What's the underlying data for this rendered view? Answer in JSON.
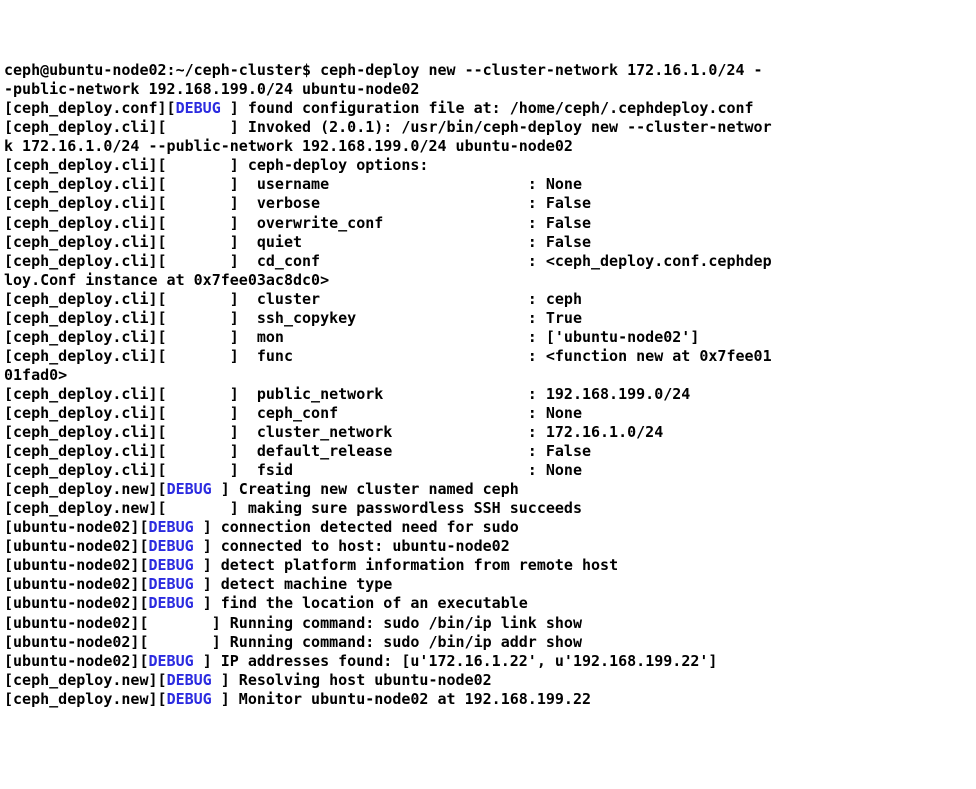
{
  "lines": [
    [
      [
        "ceph@ubuntu-node02:~/ceph-cluster$ ceph-deploy new --cluster-network 172.16.1.0/24 -"
      ]
    ],
    [
      [
        "-public-network 192.168.199.0/24 ubuntu-node02"
      ]
    ],
    [
      [
        "[ceph_deploy.conf]["
      ],
      [
        "lvl",
        "DEBUG "
      ],
      [
        "] found configuration file at: /home/ceph/.cephdeploy.conf"
      ]
    ],
    [
      [
        "[ceph_deploy.cli][       ] Invoked (2.0.1): /usr/bin/ceph-deploy new --cluster-networ"
      ]
    ],
    [
      [
        "k 172.16.1.0/24 --public-network 192.168.199.0/24 ubuntu-node02"
      ]
    ],
    [
      [
        "[ceph_deploy.cli][       ] ceph-deploy options:"
      ]
    ],
    [
      [
        "[ceph_deploy.cli][       ]  username                      : None"
      ]
    ],
    [
      [
        "[ceph_deploy.cli][       ]  verbose                       : False"
      ]
    ],
    [
      [
        "[ceph_deploy.cli][       ]  overwrite_conf                : False"
      ]
    ],
    [
      [
        "[ceph_deploy.cli][       ]  quiet                         : False"
      ]
    ],
    [
      [
        "[ceph_deploy.cli][       ]  cd_conf                       : <ceph_deploy.conf.cephdep"
      ]
    ],
    [
      [
        "loy.Conf instance at 0x7fee03ac8dc0>"
      ]
    ],
    [
      [
        "[ceph_deploy.cli][       ]  cluster                       : ceph"
      ]
    ],
    [
      [
        "[ceph_deploy.cli][       ]  ssh_copykey                   : True"
      ]
    ],
    [
      [
        "[ceph_deploy.cli][       ]  mon                           : ['ubuntu-node02']"
      ]
    ],
    [
      [
        "[ceph_deploy.cli][       ]  func                          : <function new at 0x7fee01"
      ]
    ],
    [
      [
        "01fad0>"
      ]
    ],
    [
      [
        "[ceph_deploy.cli][       ]  public_network                : 192.168.199.0/24"
      ]
    ],
    [
      [
        "[ceph_deploy.cli][       ]  ceph_conf                     : None"
      ]
    ],
    [
      [
        "[ceph_deploy.cli][       ]  cluster_network               : 172.16.1.0/24"
      ]
    ],
    [
      [
        "[ceph_deploy.cli][       ]  default_release               : False"
      ]
    ],
    [
      [
        "[ceph_deploy.cli][       ]  fsid                          : None"
      ]
    ],
    [
      [
        "[ceph_deploy.new]["
      ],
      [
        "lvl",
        "DEBUG "
      ],
      [
        "] Creating new cluster named ceph"
      ]
    ],
    [
      [
        "[ceph_deploy.new][       ] making sure passwordless SSH succeeds"
      ]
    ],
    [
      [
        "[ubuntu-node02]["
      ],
      [
        "lvl",
        "DEBUG "
      ],
      [
        "] connection detected need for sudo"
      ]
    ],
    [
      [
        "[ubuntu-node02]["
      ],
      [
        "lvl",
        "DEBUG "
      ],
      [
        "] connected to host: ubuntu-node02"
      ]
    ],
    [
      [
        "[ubuntu-node02]["
      ],
      [
        "lvl",
        "DEBUG "
      ],
      [
        "] detect platform information from remote host"
      ]
    ],
    [
      [
        "[ubuntu-node02]["
      ],
      [
        "lvl",
        "DEBUG "
      ],
      [
        "] detect machine type"
      ]
    ],
    [
      [
        "[ubuntu-node02]["
      ],
      [
        "lvl",
        "DEBUG "
      ],
      [
        "] find the location of an executable"
      ]
    ],
    [
      [
        "[ubuntu-node02][       ] Running command: sudo /bin/ip link show"
      ]
    ],
    [
      [
        "[ubuntu-node02][       ] Running command: sudo /bin/ip addr show"
      ]
    ],
    [
      [
        "[ubuntu-node02]["
      ],
      [
        "lvl",
        "DEBUG "
      ],
      [
        "] IP addresses found: [u'172.16.1.22', u'192.168.199.22']"
      ]
    ],
    [
      [
        "[ceph_deploy.new]["
      ],
      [
        "lvl",
        "DEBUG "
      ],
      [
        "] Resolving host ubuntu-node02"
      ]
    ],
    [
      [
        "[ceph_deploy.new]["
      ],
      [
        "lvl",
        "DEBUG "
      ],
      [
        "] Monitor ubuntu-node02 at 192.168.199.22"
      ]
    ]
  ]
}
